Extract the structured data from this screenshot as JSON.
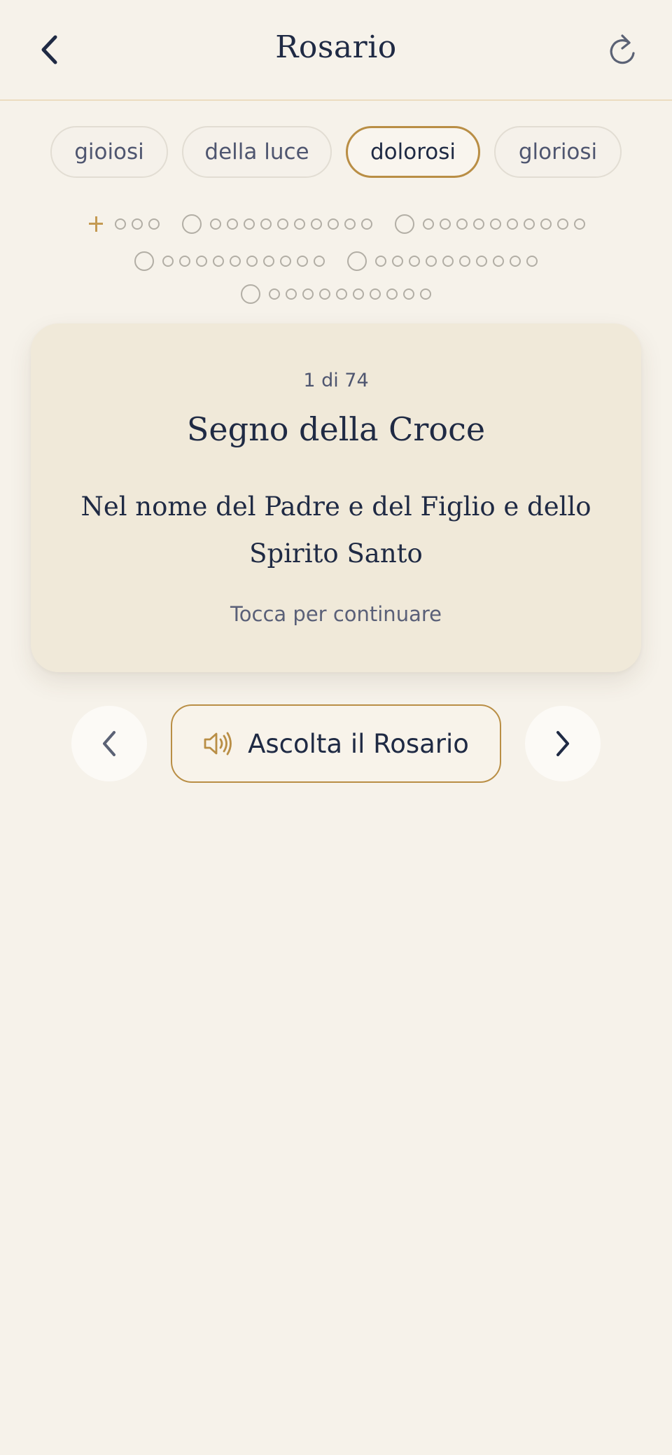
{
  "header": {
    "title": "Rosario",
    "back_icon": "chevron-left-icon",
    "reset_icon": "refresh-icon"
  },
  "mysteries": {
    "tabs": [
      {
        "label": "gioiosi",
        "active": false
      },
      {
        "label": "della luce",
        "active": false
      },
      {
        "label": "dolorosi",
        "active": true
      },
      {
        "label": "gloriosi",
        "active": false
      }
    ]
  },
  "progress": {
    "intro_beads": 3,
    "decades": 5,
    "beads_per_decade": 10,
    "current_step": 1
  },
  "card": {
    "counter": "1 di 74",
    "title": "Segno della Croce",
    "text": "Nel nome del Padre e del Figlio e dello Spirito Santo",
    "hint": "Tocca per continuare"
  },
  "controls": {
    "listen_label": "Ascolta il Rosario",
    "prev_icon": "chevron-left-icon",
    "next_icon": "chevron-right-icon",
    "speaker_icon": "speaker-icon"
  },
  "colors": {
    "background": "#f6f2ea",
    "accent": "#b98e45",
    "text": "#1f2a44",
    "card": "#f0e9d9"
  }
}
